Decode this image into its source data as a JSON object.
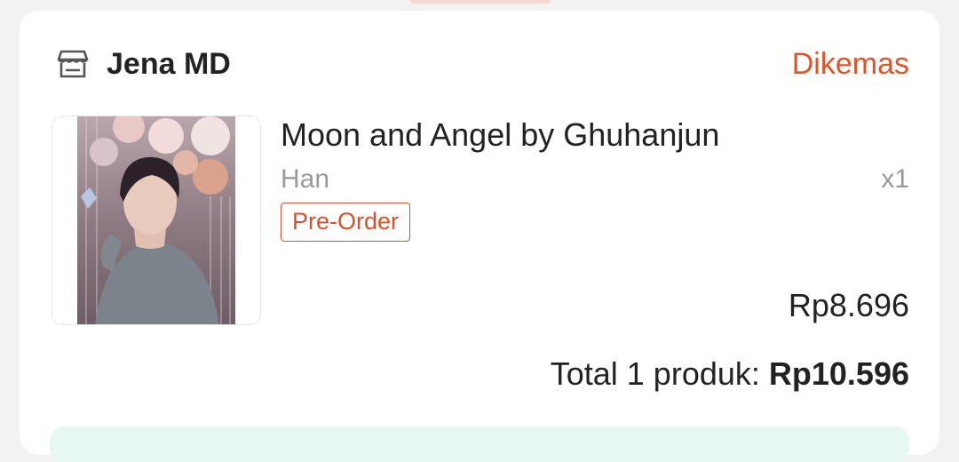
{
  "shop": {
    "icon": "store-icon",
    "name": "Jena MD",
    "status": "Dikemas"
  },
  "product": {
    "title": "Moon and Angel by Ghuhanjun",
    "variant": "Han",
    "quantity": "x1",
    "tag": "Pre-Order",
    "price": "Rp8.696"
  },
  "summary": {
    "label": "Total 1 produk: ",
    "amount": "Rp10.596"
  },
  "colors": {
    "accent": "#e0542c",
    "muted": "#9a9a9a",
    "text": "#222222"
  }
}
